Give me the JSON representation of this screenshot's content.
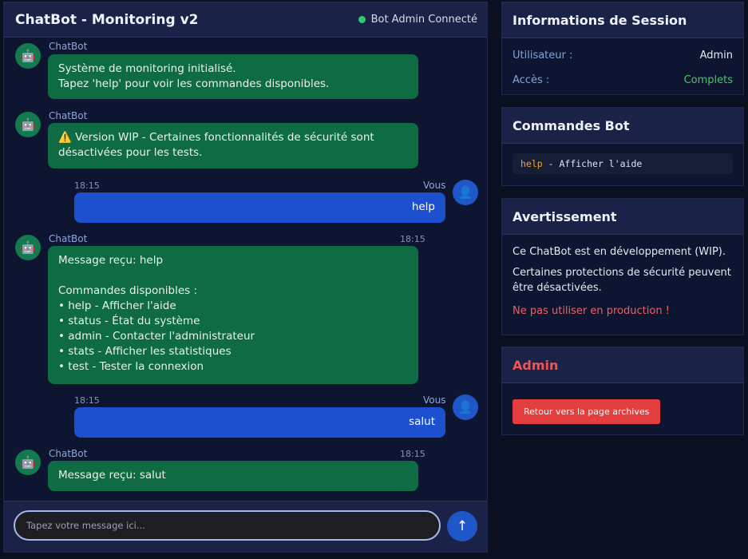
{
  "chat": {
    "title": "ChatBot - Monitoring v2",
    "status_text": "Bot Admin Connecté",
    "bot_icon": "robot-icon",
    "user_icon": "user-icon",
    "messages": [
      {
        "sender": "ChatBot",
        "time": "",
        "lines": [
          "Système de monitoring initialisé.",
          "Tapez 'help' pour voir les commandes disponibles."
        ]
      },
      {
        "sender": "ChatBot",
        "time": "",
        "lines": [
          "⚠️ Version WIP - Certaines fonctionnalités de sécurité sont désactivées pour les tests."
        ]
      },
      {
        "sender": "Vous",
        "time": "18:15",
        "text": "help"
      },
      {
        "sender": "ChatBot",
        "time": "18:15",
        "lines": [
          "Message reçu: help",
          "",
          "Commandes disponibles :",
          "• help - Afficher l'aide",
          "• status - État du système",
          "• admin - Contacter l'administrateur",
          "• stats - Afficher les statistiques",
          "• test - Tester la connexion"
        ]
      },
      {
        "sender": "Vous",
        "time": "18:15",
        "text": "salut"
      },
      {
        "sender": "ChatBot",
        "time": "18:15",
        "lines": [
          "Message reçu: salut"
        ]
      }
    ],
    "input_placeholder": "Tapez votre message ici...",
    "send_glyph": "↑"
  },
  "session": {
    "title": "Informations de Session",
    "user_label": "Utilisateur :",
    "user_value": "Admin",
    "access_label": "Accès :",
    "access_value": "Complets"
  },
  "commands": {
    "title": "Commandes Bot",
    "keyword": "help",
    "description": " - Afficher l'aide"
  },
  "warning": {
    "title": "Avertissement",
    "p1": "Ce ChatBot est en développement (WIP).",
    "p2": "Certaines protections de sécurité peuvent être désactivées.",
    "p3": "Ne pas utiliser en production !"
  },
  "admin": {
    "title": "Admin",
    "button": "Retour vers la page archives"
  },
  "colors": {
    "bot_bubble": "#0f6b44",
    "user_bubble": "#1c50cf",
    "danger": "#e53e3e",
    "online": "#2ecc71"
  }
}
